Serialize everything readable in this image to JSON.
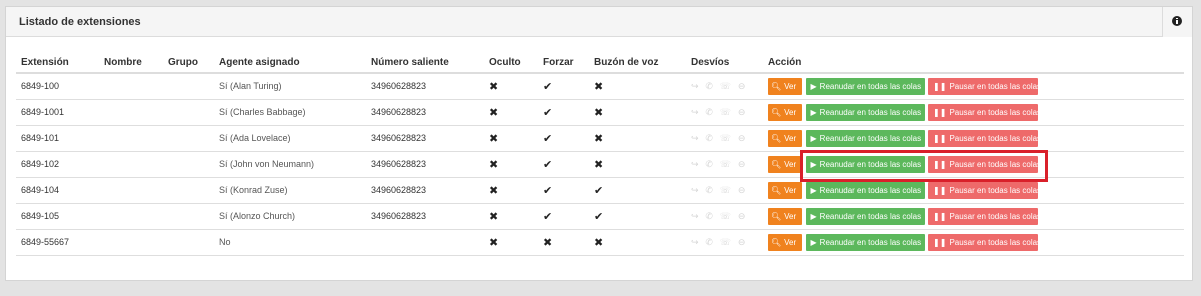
{
  "panel": {
    "title": "Listado de extensiones",
    "info_icon": "info-circle-icon"
  },
  "table": {
    "headers": [
      "Extensión",
      "Nombre",
      "Grupo",
      "Agente asignado",
      "Número saliente",
      "Oculto",
      "Forzar",
      "Buzón de voz",
      "Desvíos",
      "Acción"
    ],
    "rows": [
      {
        "ext": "6849-100",
        "nombre": "",
        "grupo": "",
        "agente": "Sí (Alan Turing)",
        "numero": "34960628823",
        "oculto": "✖",
        "forzar": "✔",
        "buzon": "✖"
      },
      {
        "ext": "6849-1001",
        "nombre": "",
        "grupo": "",
        "agente": "Sí (Charles Babbage)",
        "numero": "34960628823",
        "oculto": "✖",
        "forzar": "✔",
        "buzon": "✖"
      },
      {
        "ext": "6849-101",
        "nombre": "",
        "grupo": "",
        "agente": "Sí (Ada Lovelace)",
        "numero": "34960628823",
        "oculto": "✖",
        "forzar": "✔",
        "buzon": "✖"
      },
      {
        "ext": "6849-102",
        "nombre": "",
        "grupo": "",
        "agente": "Sí (John von Neumann)",
        "numero": "34960628823",
        "oculto": "✖",
        "forzar": "✔",
        "buzon": "✖"
      },
      {
        "ext": "6849-104",
        "nombre": "",
        "grupo": "",
        "agente": "Sí (Konrad Zuse)",
        "numero": "34960628823",
        "oculto": "✖",
        "forzar": "✔",
        "buzon": "✔"
      },
      {
        "ext": "6849-105",
        "nombre": "",
        "grupo": "",
        "agente": "Sí (Alonzo Church)",
        "numero": "34960628823",
        "oculto": "✖",
        "forzar": "✔",
        "buzon": "✔"
      },
      {
        "ext": "6849-55667",
        "nombre": "",
        "grupo": "",
        "agente": "No",
        "numero": "",
        "oculto": "✖",
        "forzar": "✖",
        "buzon": "✖"
      }
    ],
    "desvios_icons": "↪ ✆ ☏ ⊖",
    "actions": {
      "ver_label": "Ver",
      "resume_label": "Reanudar en todas las colas",
      "pause_label": "Pausar en todas las colas"
    }
  },
  "colors": {
    "ver": "#f0821e",
    "resume": "#5cb85c",
    "pause": "#ee6a6a",
    "highlight": "#d9202a"
  }
}
